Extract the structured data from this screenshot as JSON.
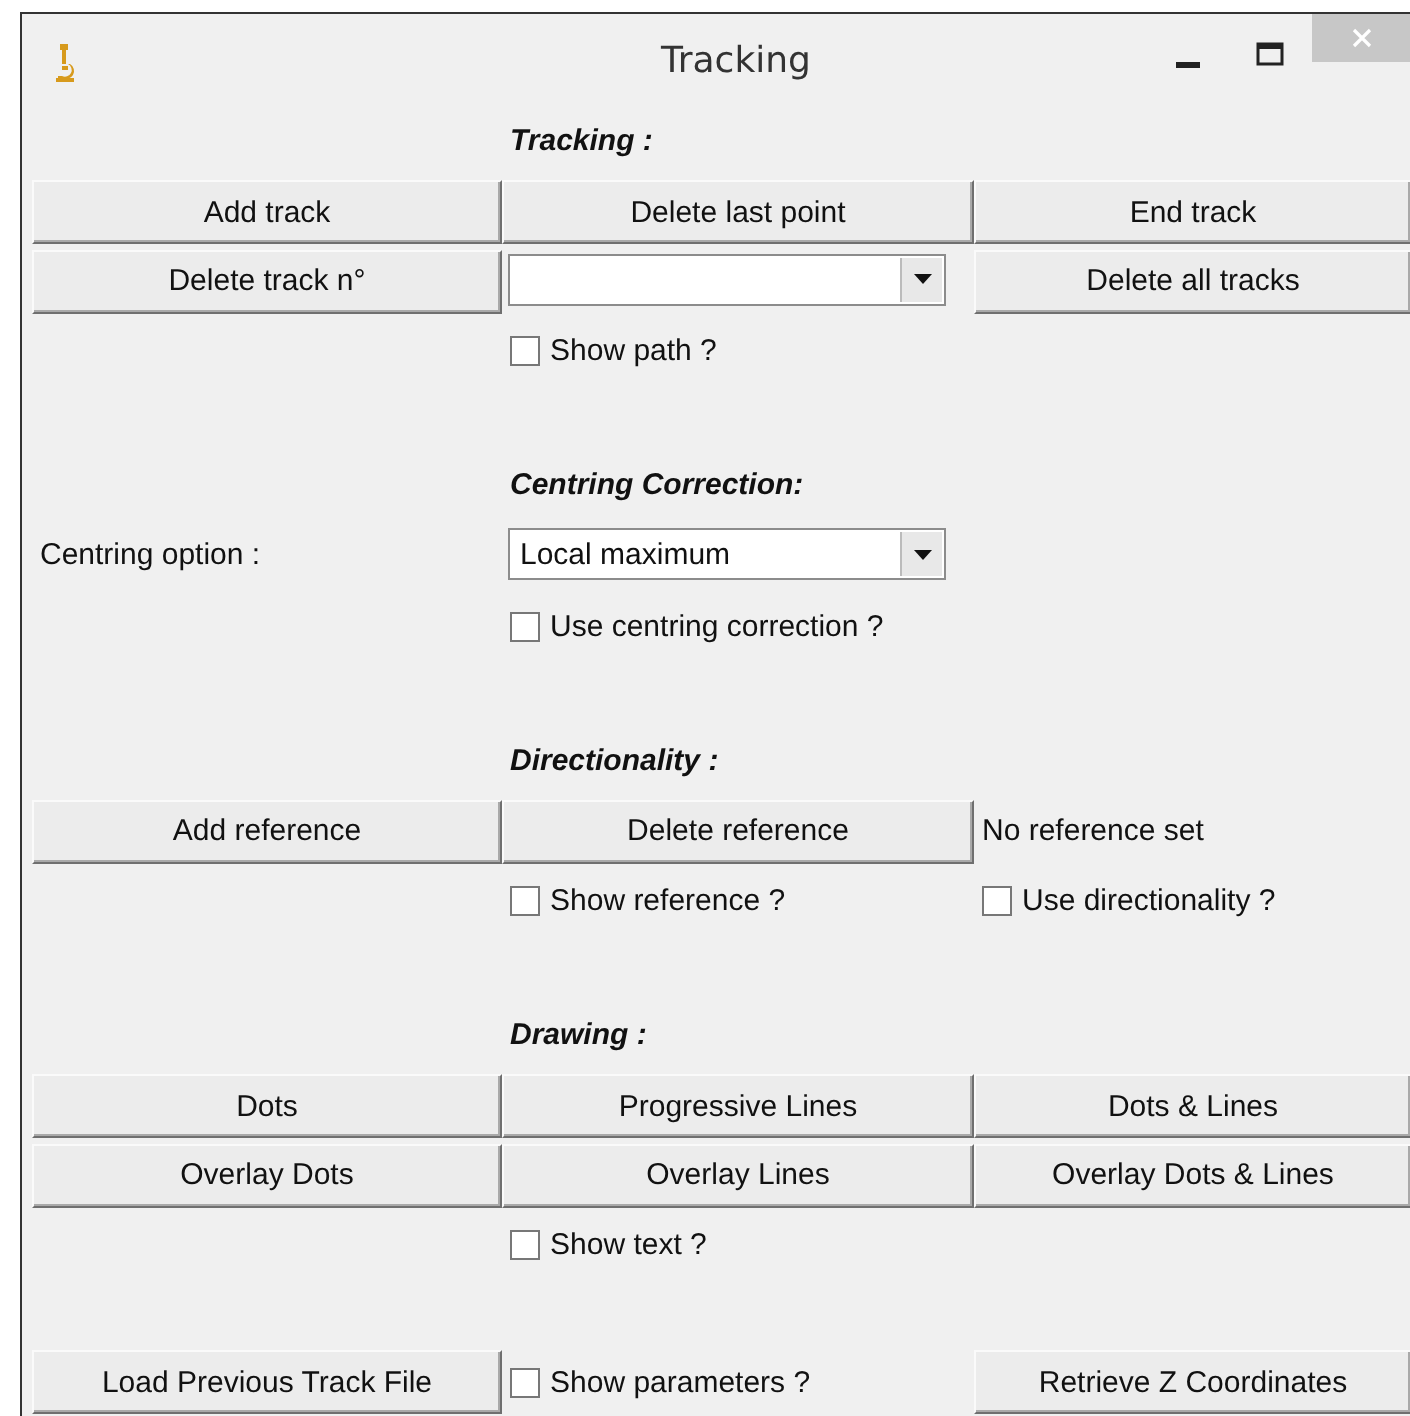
{
  "window": {
    "title": "Tracking"
  },
  "rows": [
    {
      "cells": [
        {
          "kind": "empty"
        },
        {
          "kind": "heading",
          "text": "Tracking :"
        },
        {
          "kind": "empty"
        }
      ]
    },
    {
      "cells": [
        {
          "kind": "button",
          "text": "Add track"
        },
        {
          "kind": "button",
          "text": "Delete last point"
        },
        {
          "kind": "button",
          "text": "End track"
        }
      ]
    },
    {
      "cells": [
        {
          "kind": "button",
          "text": "Delete track n°"
        },
        {
          "kind": "dropdown"
        },
        {
          "kind": "button",
          "text": "Delete all tracks"
        }
      ]
    },
    {
      "cells": [
        {
          "kind": "empty"
        },
        {
          "kind": "checkbox",
          "text": "Show path ?",
          "checked": false
        },
        {
          "kind": "empty"
        }
      ]
    },
    {
      "cells": [
        {
          "kind": "empty"
        },
        {
          "kind": "empty"
        },
        {
          "kind": "empty"
        }
      ]
    },
    {
      "cells": [
        {
          "kind": "empty"
        },
        {
          "kind": "heading",
          "text": "Centring Correction:"
        },
        {
          "kind": "empty"
        }
      ]
    },
    {
      "cells": [
        {
          "kind": "label",
          "text": "Centring option :"
        },
        {
          "kind": "dropdown",
          "value": "Local maximum"
        },
        {
          "kind": "empty"
        }
      ]
    },
    {
      "cells": [
        {
          "kind": "empty"
        },
        {
          "kind": "checkbox",
          "text": "Use centring correction ?",
          "checked": false
        },
        {
          "kind": "empty"
        }
      ]
    },
    {
      "cells": [
        {
          "kind": "empty"
        },
        {
          "kind": "empty"
        },
        {
          "kind": "empty"
        }
      ]
    },
    {
      "cells": [
        {
          "kind": "empty"
        },
        {
          "kind": "heading",
          "text": "Directionality :"
        },
        {
          "kind": "empty"
        }
      ]
    },
    {
      "cells": [
        {
          "kind": "button",
          "text": "Add reference"
        },
        {
          "kind": "button",
          "text": "Delete reference"
        },
        {
          "kind": "label",
          "text": "No reference set"
        }
      ]
    },
    {
      "cells": [
        {
          "kind": "empty"
        },
        {
          "kind": "checkbox",
          "text": "Show reference ?",
          "checked": false
        },
        {
          "kind": "checkbox",
          "text": "Use directionality ?",
          "checked": false
        }
      ]
    },
    {
      "cells": [
        {
          "kind": "empty"
        },
        {
          "kind": "empty"
        },
        {
          "kind": "empty"
        }
      ]
    },
    {
      "cells": [
        {
          "kind": "empty"
        },
        {
          "kind": "heading",
          "text": "Drawing :"
        },
        {
          "kind": "empty"
        }
      ]
    },
    {
      "cells": [
        {
          "kind": "button",
          "text": "Dots"
        },
        {
          "kind": "button",
          "text": "Progressive Lines"
        },
        {
          "kind": "button",
          "text": "Dots & Lines"
        }
      ]
    },
    {
      "cells": [
        {
          "kind": "button",
          "text": "Overlay Dots"
        },
        {
          "kind": "button",
          "text": "Overlay Lines"
        },
        {
          "kind": "button",
          "text": "Overlay Dots & Lines"
        }
      ]
    },
    {
      "cells": [
        {
          "kind": "empty"
        },
        {
          "kind": "checkbox",
          "text": "Show text ?",
          "checked": false
        },
        {
          "kind": "empty"
        }
      ]
    },
    {
      "cells": [
        {
          "kind": "empty"
        },
        {
          "kind": "empty"
        },
        {
          "kind": "empty"
        }
      ]
    },
    {
      "cells": [
        {
          "kind": "button",
          "text": "Load Previous Track File"
        },
        {
          "kind": "checkbox",
          "text": "Show parameters ?",
          "checked": false
        },
        {
          "kind": "button",
          "text": "Retrieve Z Coordinates"
        }
      ]
    }
  ]
}
